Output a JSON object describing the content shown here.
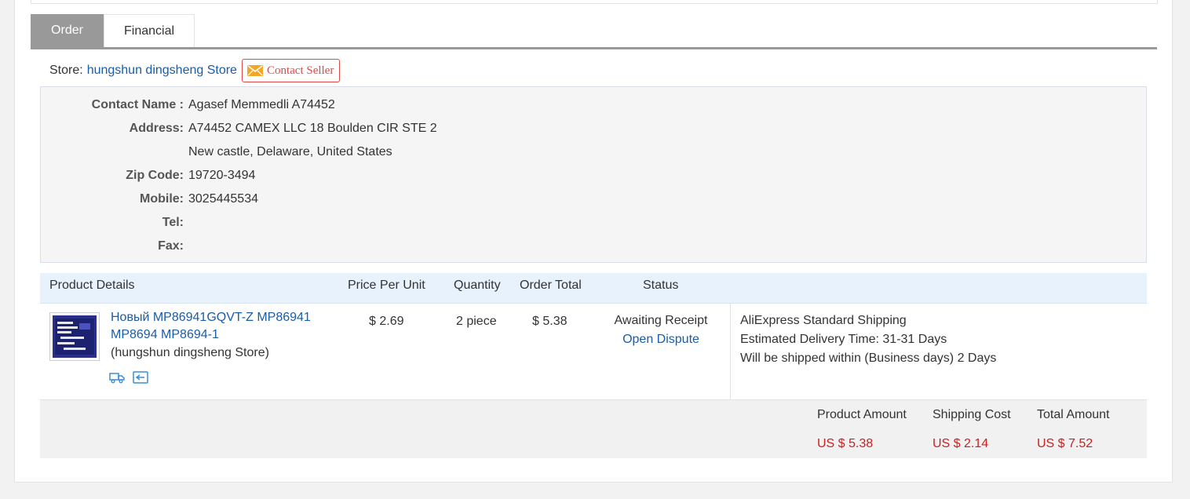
{
  "tabs": [
    {
      "label": "Order",
      "active": true
    },
    {
      "label": "Financial",
      "active": false
    }
  ],
  "store": {
    "label": "Store:",
    "name": "hungshun dingsheng Store",
    "contact_button": "Contact Seller"
  },
  "address": {
    "contact_name_label": "Contact Name :",
    "contact_name": "Agasef Memmedli A74452",
    "address_label": "Address:",
    "address_line1": "A74452 CAMEX LLC 18 Boulden CIR STE 2",
    "address_line2": "New castle, Delaware, United States",
    "zip_label": "Zip Code:",
    "zip": "19720-3494",
    "mobile_label": "Mobile:",
    "mobile": "3025445534",
    "tel_label": "Tel:",
    "tel": "",
    "fax_label": "Fax:",
    "fax": ""
  },
  "table": {
    "headers": {
      "product": "Product Details",
      "price": "Price Per Unit",
      "quantity": "Quantity",
      "total": "Order Total",
      "status": "Status"
    },
    "row": {
      "title": "Новый MP86941GQVT-Z MP86941 MP8694 MP8694-1",
      "store": "(hungshun dingsheng Store)",
      "price": "$ 2.69",
      "quantity": "2 piece",
      "total": "$ 5.38",
      "status": "Awaiting Receipt",
      "dispute_link": "Open Dispute",
      "shipping_method": "AliExpress Standard Shipping",
      "delivery_label": "Estimated Delivery Time:",
      "delivery_value": "31-31 Days",
      "ship_within_label": "Will be shipped within (Business days)",
      "ship_within_value": "2 Days"
    }
  },
  "summary": {
    "product_amount_label": "Product Amount",
    "product_amount": "US $ 5.38",
    "shipping_cost_label": "Shipping Cost",
    "shipping_cost": "US $ 2.14",
    "total_amount_label": "Total Amount",
    "total_amount": "US $ 7.52"
  },
  "colors": {
    "link": "#1a5ca8",
    "price_red": "#c92020",
    "contact_red": "#e04848",
    "tab_active": "#999999"
  },
  "icons": [
    "mail-icon",
    "product-thumbnail",
    "shipping-truck-icon",
    "message-icon"
  ]
}
